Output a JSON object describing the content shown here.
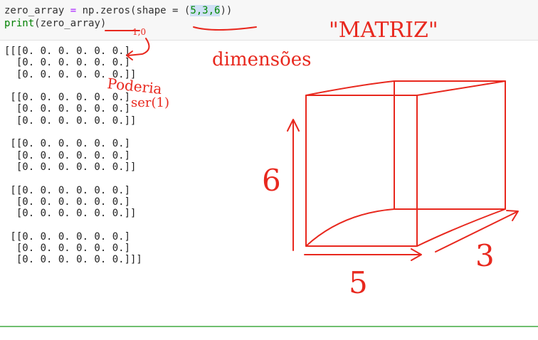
{
  "code": {
    "line1": {
      "var": "zero_array",
      "assign": " = ",
      "call": "np.zeros(shape = (",
      "args": "5,3,6",
      "close": "))"
    },
    "line2": {
      "func": "print",
      "rest": "(zero_array)"
    }
  },
  "output": {
    "blocks": [
      [
        "[[[0. 0. 0. 0. 0. 0.]",
        "  [0. 0. 0. 0. 0. 0.]",
        "  [0. 0. 0. 0. 0. 0.]]"
      ],
      [
        " [[0. 0. 0. 0. 0. 0.]",
        "  [0. 0. 0. 0. 0. 0.]",
        "  [0. 0. 0. 0. 0. 0.]]"
      ],
      [
        " [[0. 0. 0. 0. 0. 0.]",
        "  [0. 0. 0. 0. 0. 0.]",
        "  [0. 0. 0. 0. 0. 0.]]"
      ],
      [
        " [[0. 0. 0. 0. 0. 0.]",
        "  [0. 0. 0. 0. 0. 0.]",
        "  [0. 0. 0. 0. 0. 0.]]"
      ],
      [
        " [[0. 0. 0. 0. 0. 0.]",
        "  [0. 0. 0. 0. 0. 0.]",
        "  [0. 0. 0. 0. 0. 0.]]]"
      ]
    ]
  },
  "annotations": {
    "title": "\"MATRIZ\"",
    "dimensoes": "dimensões",
    "poderia": "Poderia",
    "ser": "ser(1)",
    "arrow_label": "1,0",
    "dim_height": "6",
    "dim_width": "5",
    "dim_depth": "3",
    "color": "#e8281e"
  }
}
